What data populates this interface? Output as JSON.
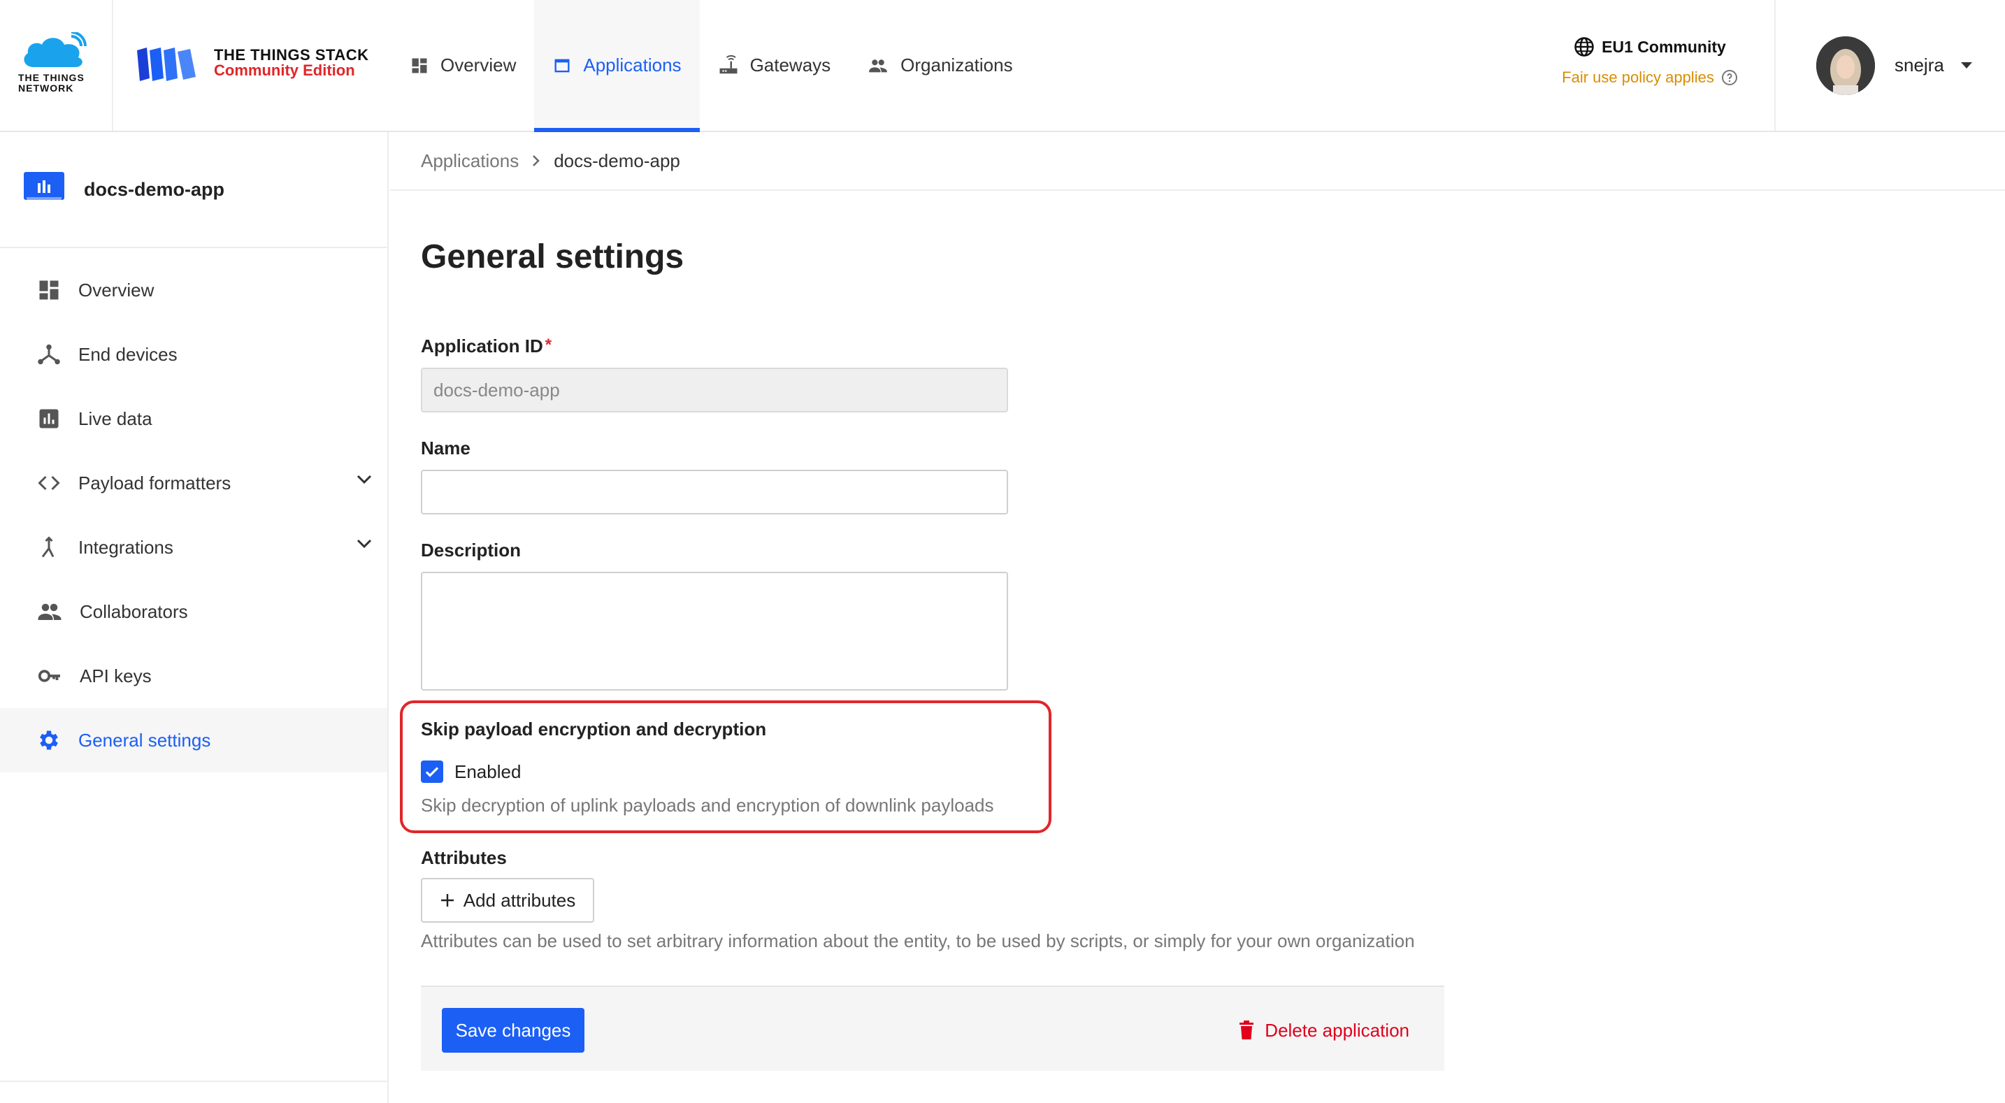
{
  "brand": {
    "ttn_text_line1": "THE THINGS",
    "ttn_text_line2": "NETWORK",
    "stack_title": "THE THINGS STACK",
    "stack_subtitle": "Community Edition"
  },
  "nav": {
    "items": [
      {
        "label": "Overview",
        "icon": "dashboard-icon"
      },
      {
        "label": "Applications",
        "icon": "application-icon",
        "active": true
      },
      {
        "label": "Gateways",
        "icon": "gateway-icon"
      },
      {
        "label": "Organizations",
        "icon": "organizations-icon"
      }
    ]
  },
  "cluster": {
    "name": "EU1 Community",
    "fair_use": "Fair use policy applies"
  },
  "user": {
    "name": "snejra"
  },
  "sidebar": {
    "app_name": "docs-demo-app",
    "items": [
      {
        "label": "Overview",
        "icon": "dashboard-icon"
      },
      {
        "label": "End devices",
        "icon": "devices-icon"
      },
      {
        "label": "Live data",
        "icon": "live-data-icon"
      },
      {
        "label": "Payload formatters",
        "icon": "code-icon",
        "expandable": true
      },
      {
        "label": "Integrations",
        "icon": "integrations-icon",
        "expandable": true
      },
      {
        "label": "Collaborators",
        "icon": "collaborators-icon"
      },
      {
        "label": "API keys",
        "icon": "key-icon"
      },
      {
        "label": "General settings",
        "icon": "gear-icon",
        "active": true
      }
    ]
  },
  "breadcrumb": {
    "parent": "Applications",
    "current": "docs-demo-app"
  },
  "form": {
    "title": "General settings",
    "app_id_label": "Application ID",
    "app_id_required": "*",
    "app_id_value": "docs-demo-app",
    "name_label": "Name",
    "name_value": "",
    "description_label": "Description",
    "description_value": "",
    "skip_title": "Skip payload encryption and decryption",
    "skip_checkbox_label": "Enabled",
    "skip_checked": true,
    "skip_description": "Skip decryption of uplink payloads and encryption of downlink payloads",
    "attributes_label": "Attributes",
    "add_attributes_label": "Add attributes",
    "attributes_description": "Attributes can be used to set arbitrary information about the entity, to be used by scripts, or simply for your own organization"
  },
  "actions": {
    "save_label": "Save changes",
    "delete_label": "Delete application"
  },
  "colors": {
    "accent": "#1b5ff5",
    "danger": "#e0001b",
    "highlight": "#e0262a",
    "warning": "#d98d00"
  }
}
